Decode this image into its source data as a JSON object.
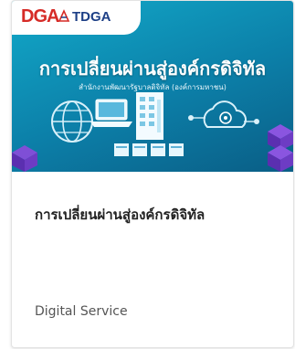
{
  "card": {
    "thumbnail": {
      "logo_dga": "DGA",
      "logo_tdga": "TDGA",
      "headline": "การเปลี่ยนผ่านสู่องค์กรดิจิทัล",
      "subline": "สำนักงานพัฒนารัฐบาลดิจิทัล (องค์การมหาชน)",
      "icons": [
        "globe-icon",
        "laptop-icon",
        "building-icon",
        "cloud-icon",
        "server-icon"
      ]
    },
    "title": "การเปลี่ยนผ่านสู่องค์กรดิจิทัล",
    "category": "Digital Service",
    "colors": {
      "thumbnail_bg": "#0c7fa8",
      "brand_red": "#d62b27",
      "brand_blue": "#1d3f86",
      "title_text": "#222222",
      "category_text": "#555555"
    }
  }
}
